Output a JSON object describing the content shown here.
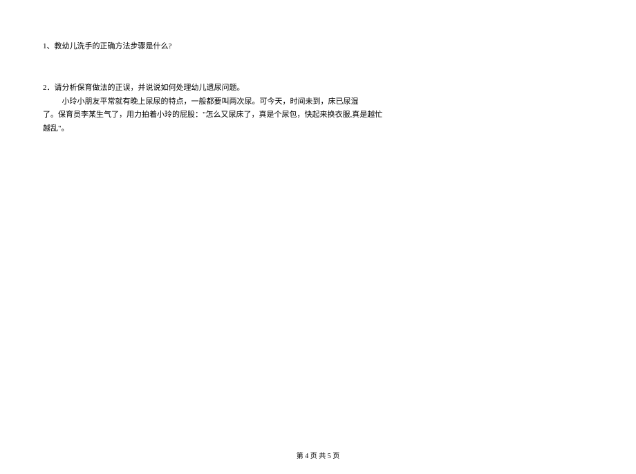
{
  "document": {
    "questions": {
      "q1": {
        "text": "1、教幼儿洗手的正确方法步骤是什么?"
      },
      "q2": {
        "line1": "2．请分析保育做法的正误，并说说如何处理幼儿遗尿问题。",
        "line2": "小玲小朋友平常就有晚上尿尿的特点，一般都要叫两次尿。可今天，时间未到，床已尿湿",
        "line3": "了。保育员李某生气了，用力拍着小玲的屁股：\"怎么又尿床了，真是个尿包，快起来换衣服,真是越忙",
        "line4": "越乱\"。"
      }
    },
    "footer": {
      "pageInfo": "第 4 页 共 5 页"
    }
  }
}
